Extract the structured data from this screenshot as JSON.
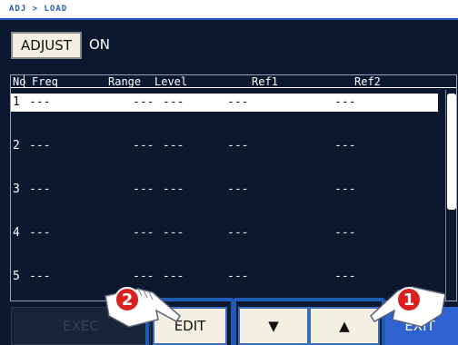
{
  "breadcrumb": "ADJ > LOAD",
  "adjust": {
    "label": "ADJUST",
    "value": "ON"
  },
  "table": {
    "headers": {
      "no": "No",
      "freq": "Freq",
      "range": "Range",
      "level": "Level",
      "ref1": "Ref1",
      "ref2": "Ref2"
    },
    "rows": [
      {
        "no": "1",
        "freq": "---",
        "range": "---",
        "level": "---",
        "ref1": "---",
        "ref2": "---"
      },
      {
        "no": "2",
        "freq": "---",
        "range": "---",
        "level": "---",
        "ref1": "---",
        "ref2": "---"
      },
      {
        "no": "3",
        "freq": "---",
        "range": "---",
        "level": "---",
        "ref1": "---",
        "ref2": "---"
      },
      {
        "no": "4",
        "freq": "---",
        "range": "---",
        "level": "---",
        "ref1": "---",
        "ref2": "---"
      },
      {
        "no": "5",
        "freq": "---",
        "range": "---",
        "level": "---",
        "ref1": "---",
        "ref2": "---"
      }
    ]
  },
  "buttons": {
    "exec": "EXEC",
    "edit": "EDIT",
    "down": "▼",
    "up": "▲",
    "exit": "EXIT"
  },
  "callouts": {
    "one": "1",
    "two": "2"
  },
  "colors": {
    "accent": "#1f5bb5",
    "background": "#0b1830",
    "exit": "#2d62d0",
    "callout": "#d92020"
  }
}
